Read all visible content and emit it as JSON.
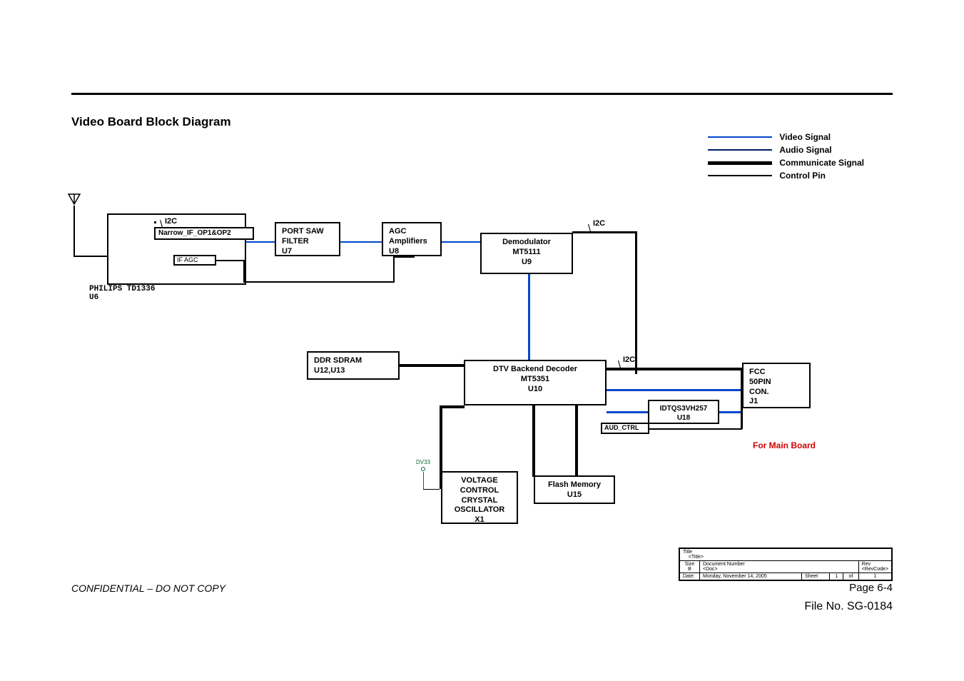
{
  "header": {
    "title": "Video Board Block Diagram"
  },
  "legend": {
    "video": "Video Signal",
    "audio": "Audio Signal",
    "comm": "Communicate Signal",
    "ctrl": "Control Pin"
  },
  "blocks": {
    "tuner_label": "PHILIPS TD1336\nU6",
    "saw": "PORT SAW\nFILTER\nU7",
    "agc": "AGC\nAmplifiers\nU8",
    "demod": "Demodulator\nMT5111\nU9",
    "ddr": "DDR SDRAM\nU12,U13",
    "dtv": "DTV Backend Decoder\nMT5351\nU10",
    "idtqs": "IDTQS3VH257\nU18",
    "fcc": "FCC\n50PIN\nCON.\nJ1",
    "vco": "VOLTAGE\nCONTROL\nCRYSTAL\nOSCILLATOR\nX1",
    "flash": "Flash Memory\nU15"
  },
  "signals": {
    "i2c": "I2C",
    "narrow": "Narrow_IF_OP1&OP2",
    "ifagc": "IF AGC",
    "aud_ctrl": "AUD_CTRL",
    "dv33": "DV33"
  },
  "notes": {
    "for_main": "For Main Board"
  },
  "titleblock": {
    "title_label": "Title",
    "title_value": "<Title>",
    "size_label": "Size",
    "size_value": "B",
    "docnum_label": "Document Number",
    "docnum_value": "<Doc>",
    "rev_label": "Rev",
    "rev_value": "<RevCode>",
    "date_label": "Date:",
    "date_value": "Monday, November 14, 2005",
    "sheet_label": "Sheet",
    "sheet_current": "1",
    "sheet_of": "of",
    "sheet_total": "1"
  },
  "footer": {
    "conf": "CONFIDENTIAL – DO NOT COPY",
    "page": "Page  6-4",
    "file": "File  No.  SG-0184"
  }
}
